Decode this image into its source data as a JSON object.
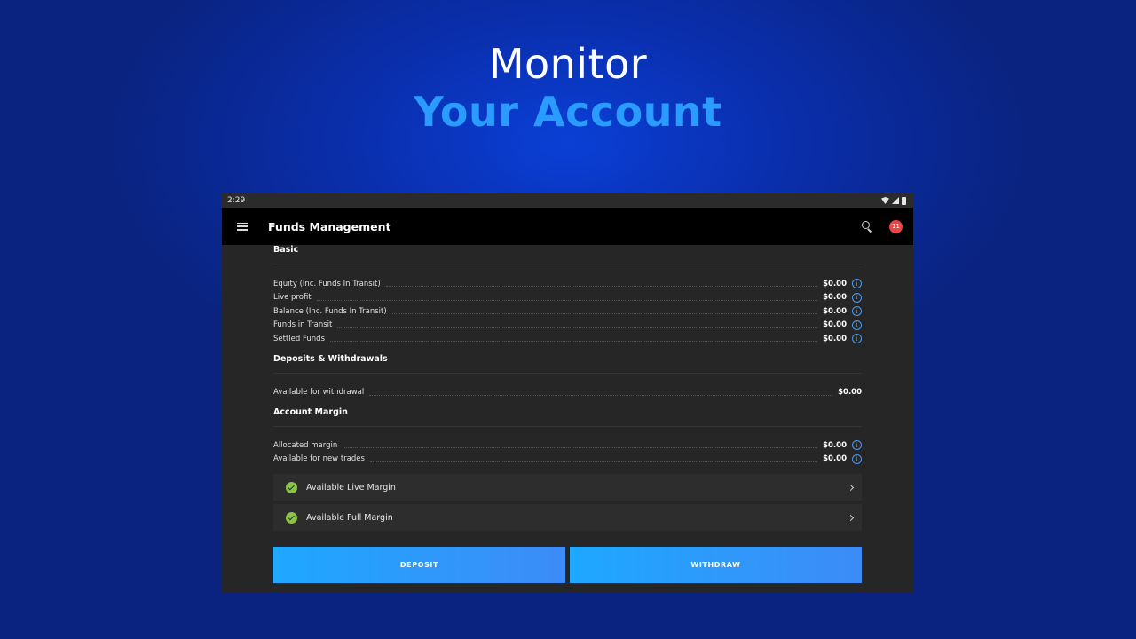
{
  "hero": {
    "line1": "Monitor",
    "line2": "Your Account"
  },
  "status_bar": {
    "time": "2:29"
  },
  "app_bar": {
    "title": "Funds Management",
    "notification_count": "11"
  },
  "sections": {
    "basic": {
      "title": "Basic",
      "rows": [
        {
          "label": "Equity (Inc. Funds In Transit)",
          "value": "$0.00"
        },
        {
          "label": "Live profit",
          "value": "$0.00"
        },
        {
          "label": "Balance (Inc. Funds In Transit)",
          "value": "$0.00"
        },
        {
          "label": "Funds in Transit",
          "value": "$0.00"
        },
        {
          "label": "Settled Funds",
          "value": "$0.00"
        }
      ]
    },
    "deposits": {
      "title": "Deposits & Withdrawals",
      "rows": [
        {
          "label": "Available for withdrawal",
          "value": "$0.00"
        }
      ]
    },
    "margin": {
      "title": "Account Margin",
      "rows": [
        {
          "label": "Allocated margin",
          "value": "$0.00"
        },
        {
          "label": "Available for new trades",
          "value": "$0.00"
        }
      ],
      "items": [
        {
          "label": "Available Live Margin"
        },
        {
          "label": "Available Full Margin"
        }
      ]
    }
  },
  "buttons": {
    "deposit": "DEPOSIT",
    "withdraw": "WITHDRAW"
  },
  "colors": {
    "accent": "#2a9cff",
    "badge": "#e84545",
    "check": "#8bc34a",
    "info": "#4a9cf0"
  },
  "icons": [
    "menu-icon",
    "search-icon",
    "info-icon",
    "check-circle-icon",
    "chevron-right-icon",
    "wifi-icon",
    "signal-icon",
    "battery-icon"
  ]
}
